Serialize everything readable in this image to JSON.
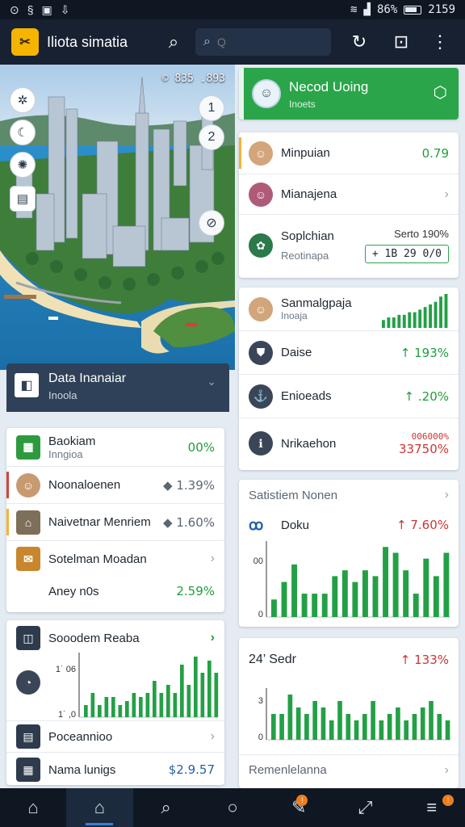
{
  "status": {
    "time": "2159",
    "battery": "86%"
  },
  "app": {
    "title": "Iliota simatia",
    "logo": "✂"
  },
  "search": {
    "placeholder": "Q"
  },
  "map": {
    "tag": "© 835 .893",
    "numbers": [
      "1",
      "2"
    ]
  },
  "data_panel": {
    "title": "Data Inanaiar",
    "subtitle": "Inoola"
  },
  "left_list": [
    {
      "label": "Baokiam",
      "sub": "Inngioa",
      "value": "00%",
      "tone": "green"
    },
    {
      "label": "Noonaloenen",
      "value": "◆ 1.39%",
      "tone": "mut"
    },
    {
      "label": "Naivetnar Menriem",
      "value": "◆ 1.60%",
      "tone": "mut"
    },
    {
      "label": "Sotelman Moadan",
      "value": "",
      "tone": "mut"
    },
    {
      "label": "Aney n0s",
      "value": "2.59%",
      "tone": "green"
    }
  ],
  "left_chart_card": {
    "title": "Sooodem Reaba",
    "chart_data": {
      "type": "bar",
      "y_ticks": [
        "1˙ 06",
        "1˙ ,0"
      ],
      "values": [
        3,
        6,
        3,
        5,
        5,
        3,
        4,
        6,
        5,
        6,
        9,
        6,
        8,
        6,
        13,
        8,
        15,
        11,
        14,
        11
      ],
      "ylim": [
        0,
        16
      ]
    },
    "rows": [
      {
        "label": "Poceannioo",
        "value": ""
      },
      {
        "label": "Nama lunigs",
        "value": "$2.9.57"
      }
    ]
  },
  "header_card": {
    "title": "Necod Uoing",
    "subtitle": "Inoets"
  },
  "right_list_1": [
    {
      "label": "Minpuian",
      "value": "0.79",
      "tone": "green"
    },
    {
      "label": "Mianajena",
      "value": "",
      "tone": "mut"
    },
    {
      "label": "Soplchian",
      "sub": "Reotinapa",
      "value": "Serto 190%",
      "box": "+ 1B 29 0/0"
    }
  ],
  "right_list_2": {
    "head": {
      "label": "Sanmalgpaja",
      "sub": "Inoaja"
    },
    "sparkline": [
      3,
      4,
      4,
      5,
      5,
      6,
      6,
      7,
      8,
      9,
      10,
      12,
      13
    ],
    "rows": [
      {
        "label": "Daise",
        "value": "↑ 193%",
        "tone": "green"
      },
      {
        "label": "Enioeads",
        "value": "↑ .20%",
        "tone": "green"
      },
      {
        "label": "Nrikaehon",
        "value": "33750%",
        "top": "006000%",
        "tone": "red"
      }
    ]
  },
  "right_chart_1": {
    "title": "Satistiem Nonen",
    "item": "Doku",
    "value": "↑ 7.60%",
    "chart_data": {
      "type": "bar",
      "y_ticks": [
        "00",
        "0"
      ],
      "values": [
        3,
        6,
        9,
        4,
        4,
        4,
        7,
        8,
        6,
        8,
        7,
        12,
        11,
        8,
        4,
        10,
        7,
        11
      ],
      "ylim": [
        0,
        13
      ]
    }
  },
  "right_chart_2": {
    "title": "24’ Sedr",
    "value": "↑ 133%",
    "footer": "Remenlelanna",
    "chart_data": {
      "type": "bar",
      "y_ticks": [
        "3",
        "0"
      ],
      "values": [
        4,
        4,
        7,
        5,
        4,
        6,
        5,
        3,
        6,
        4,
        3,
        4,
        6,
        3,
        4,
        5,
        3,
        4,
        5,
        6,
        4,
        3
      ],
      "ylim": [
        0,
        8
      ]
    }
  },
  "nav": {
    "badge1": "!",
    "badge2": "!",
    "badge3": "!"
  }
}
